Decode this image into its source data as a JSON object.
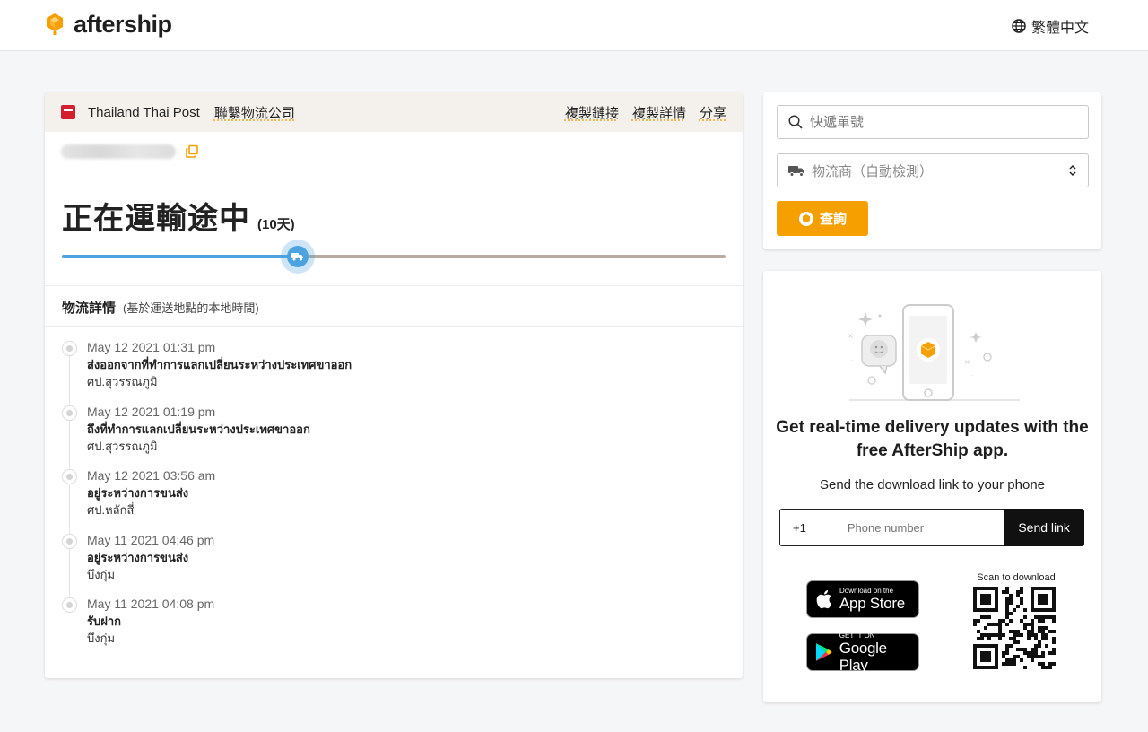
{
  "header": {
    "logo_text": "aftership",
    "language": "繁體中文"
  },
  "shipment": {
    "carrier_name": "Thailand Thai Post",
    "contact_link": "聯繫物流公司",
    "actions": [
      "複製鏈接",
      "複製詳情",
      "分享"
    ],
    "status": "正在運輸途中",
    "days": "(10天)",
    "progress": 0.355,
    "details_title": "物流詳情",
    "details_subtitle": "(基於運送地點的本地時間)",
    "events": [
      {
        "time": "May 12 2021 01:31 pm",
        "status": "ส่งออกจากที่ทำการแลกเปลี่ยนระหว่างประเทศขาออก",
        "location": "ศป.สุวรรณภูมิ"
      },
      {
        "time": "May 12 2021 01:19 pm",
        "status": "ถึงที่ทำการแลกเปลี่ยนระหว่างประเทศขาออก",
        "location": "ศป.สุวรรณภูมิ"
      },
      {
        "time": "May 12 2021 03:56 am",
        "status": "อยู่ระหว่างการขนส่ง",
        "location": "ศป.หลักสี่"
      },
      {
        "time": "May 11 2021 04:46 pm",
        "status": "อยู่ระหว่างการขนส่ง",
        "location": "บึงกุ่ม"
      },
      {
        "time": "May 11 2021 04:08 pm",
        "status": "รับฝาก",
        "location": "บึงกุ่ม"
      }
    ]
  },
  "search": {
    "tracking_placeholder": "快遞單號",
    "carrier_select": "物流商（自動檢測）",
    "button": "查詢"
  },
  "app_promo": {
    "heading": "Get real-time delivery updates with the free AfterShip app.",
    "subtitle": "Send the download link to your phone",
    "phone_code": "+1",
    "phone_placeholder": "Phone number",
    "send_button": "Send link",
    "app_store_small": "Download on the",
    "app_store_big": "App Store",
    "google_play_small": "GET IT ON",
    "google_play_big": "Google Play",
    "qr_label": "Scan to download"
  },
  "colors": {
    "brand_orange": "#f59f00",
    "progress_blue": "#4da3df",
    "progress_track": "#b8aca2",
    "carrier_red": "#d4202e"
  }
}
